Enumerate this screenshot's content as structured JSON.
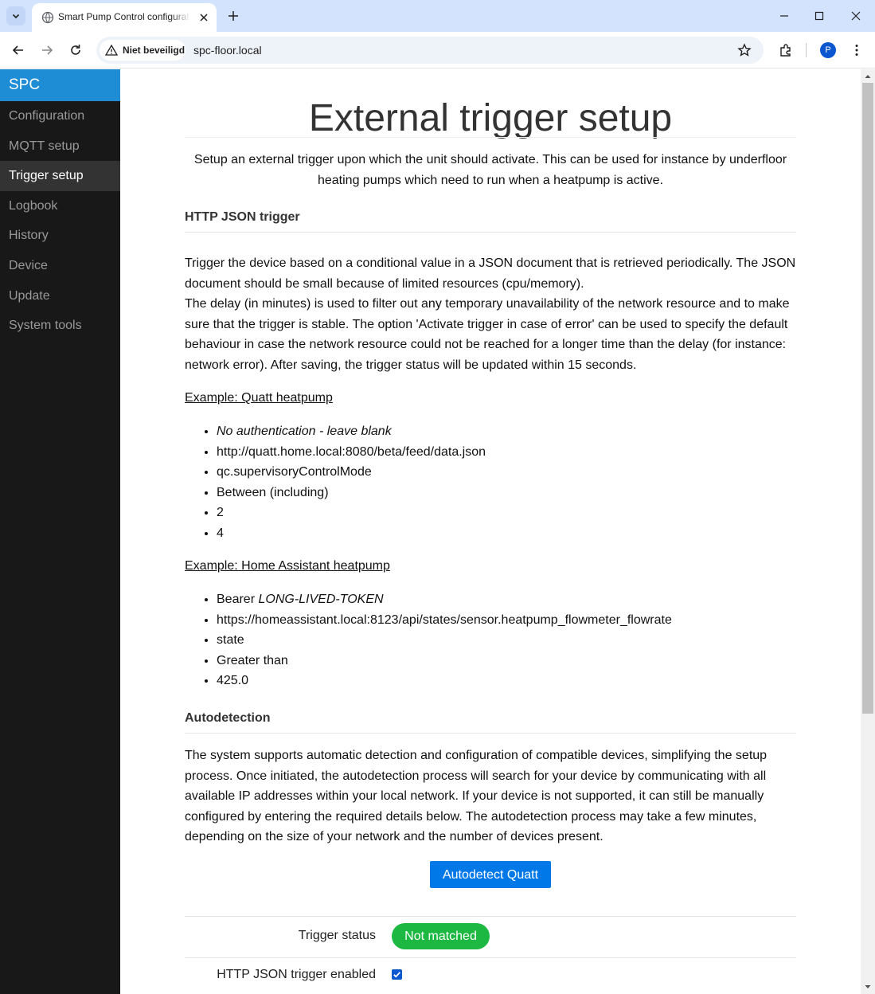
{
  "browser": {
    "tab_title": "Smart Pump Control configuratie",
    "security_label": "Niet beveiligd",
    "url": "spc-floor.local",
    "profile_initial": "P"
  },
  "sidebar": {
    "brand": "SPC",
    "items": [
      {
        "label": "Configuration",
        "active": false
      },
      {
        "label": "MQTT setup",
        "active": false
      },
      {
        "label": "Trigger setup",
        "active": true
      },
      {
        "label": "Logbook",
        "active": false
      },
      {
        "label": "History",
        "active": false
      },
      {
        "label": "Device",
        "active": false
      },
      {
        "label": "Update",
        "active": false
      },
      {
        "label": "System tools",
        "active": false
      }
    ]
  },
  "page": {
    "title": "External trigger setup",
    "intro": "Setup an external trigger upon which the unit should activate. This can be used for instance by underfloor heating pumps which need to run when a heatpump is active.",
    "http_section": {
      "heading": "HTTP JSON trigger",
      "para1": "Trigger the device based on a conditional value in a JSON document that is retrieved periodically. The JSON document should be small because of limited resources (cpu/memory).",
      "para2": "The delay (in minutes) is used to filter out any temporary unavailability of the network resource and to make sure that the trigger is stable. The option 'Activate trigger in case of error' can be used to specify the default behaviour in case the network resource could not be reached for a longer time than the delay (for instance: network error). After saving, the trigger status will be updated within 15 seconds."
    },
    "example_quatt": {
      "heading": "Example: Quatt heatpump",
      "items": [
        "No authentication - leave blank",
        "http://quatt.home.local:8080/beta/feed/data.json",
        "qc.supervisoryControlMode",
        "Between (including)",
        "2",
        "4"
      ]
    },
    "example_ha": {
      "heading": "Example: Home Assistant heatpump",
      "bearer_prefix": "Bearer ",
      "bearer_token": "LONG-LIVED-TOKEN",
      "items": [
        "https://homeassistant.local:8123/api/states/sensor.heatpump_flowmeter_flowrate",
        "state",
        "Greater than",
        "425.0"
      ]
    },
    "autodetect": {
      "heading": "Autodetection",
      "text": "The system supports automatic detection and configuration of compatible devices, simplifying the setup process. Once initiated, the autodetection process will search for your device by communicating with all available IP addresses within your local network. If your device is not supported, it can still be manually configured by entering the required details below. The autodetection process may take a few minutes, depending on the size of your network and the number of devices present.",
      "button_label": "Autodetect Quatt"
    },
    "form": {
      "trigger_status_label": "Trigger status",
      "trigger_status_value": "Not matched",
      "enabled_label": "HTTP JSON trigger enabled",
      "enabled_checked": true
    }
  },
  "colors": {
    "brand": "#1f8dd6",
    "sidebar_bg": "#191818",
    "button": "#0078e7",
    "status_pill": "#1cb841"
  }
}
